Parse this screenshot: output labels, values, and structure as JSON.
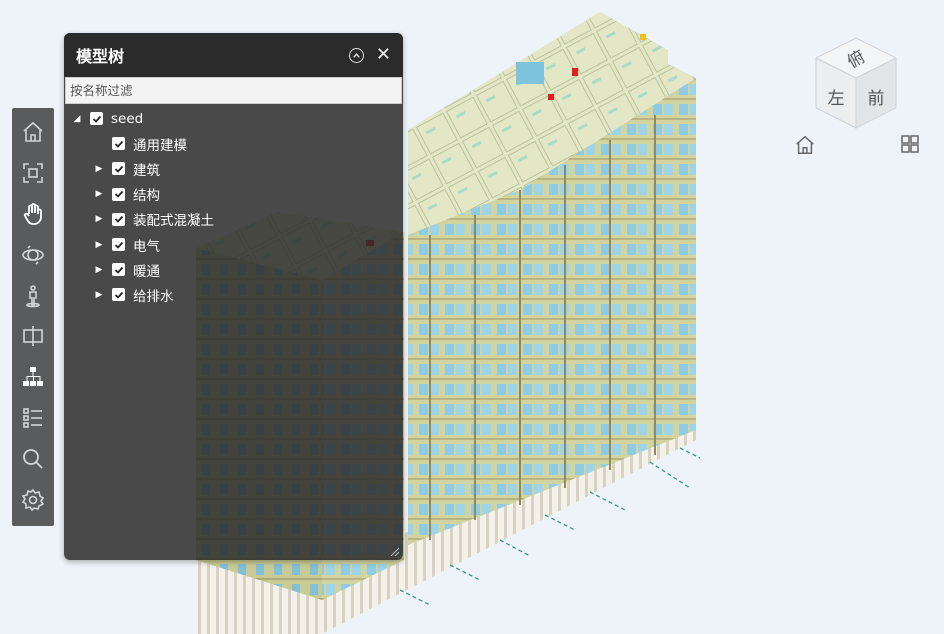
{
  "tree": {
    "title": "模型树",
    "filter_placeholder": "按名称过滤",
    "root": {
      "label": "seed",
      "checked": true,
      "expanded": true
    },
    "children": [
      {
        "label": "通用建模",
        "checked": true,
        "has_children": false
      },
      {
        "label": "建筑",
        "checked": true,
        "has_children": true
      },
      {
        "label": "结构",
        "checked": true,
        "has_children": true
      },
      {
        "label": "装配式混凝土",
        "checked": true,
        "has_children": true
      },
      {
        "label": "电气",
        "checked": true,
        "has_children": true
      },
      {
        "label": "暖通",
        "checked": true,
        "has_children": true
      },
      {
        "label": "给排水",
        "checked": true,
        "has_children": true
      }
    ]
  },
  "viewcube": {
    "top": "俯",
    "left": "左",
    "front": "前"
  },
  "toolbar": {
    "tools": [
      "home-icon",
      "fit-view-icon",
      "pan-icon",
      "orbit-icon",
      "walk-icon",
      "section-icon",
      "model-tree-icon",
      "properties-icon",
      "search-icon",
      "settings-icon"
    ],
    "active": "pan-icon"
  },
  "colors": {
    "background": "#eef3f9",
    "panel": "#2b2b2b",
    "glass": "#8fcbe2",
    "wall": "#d9dba8",
    "mullion": "#a7a070",
    "accent_red": "#e02020"
  }
}
